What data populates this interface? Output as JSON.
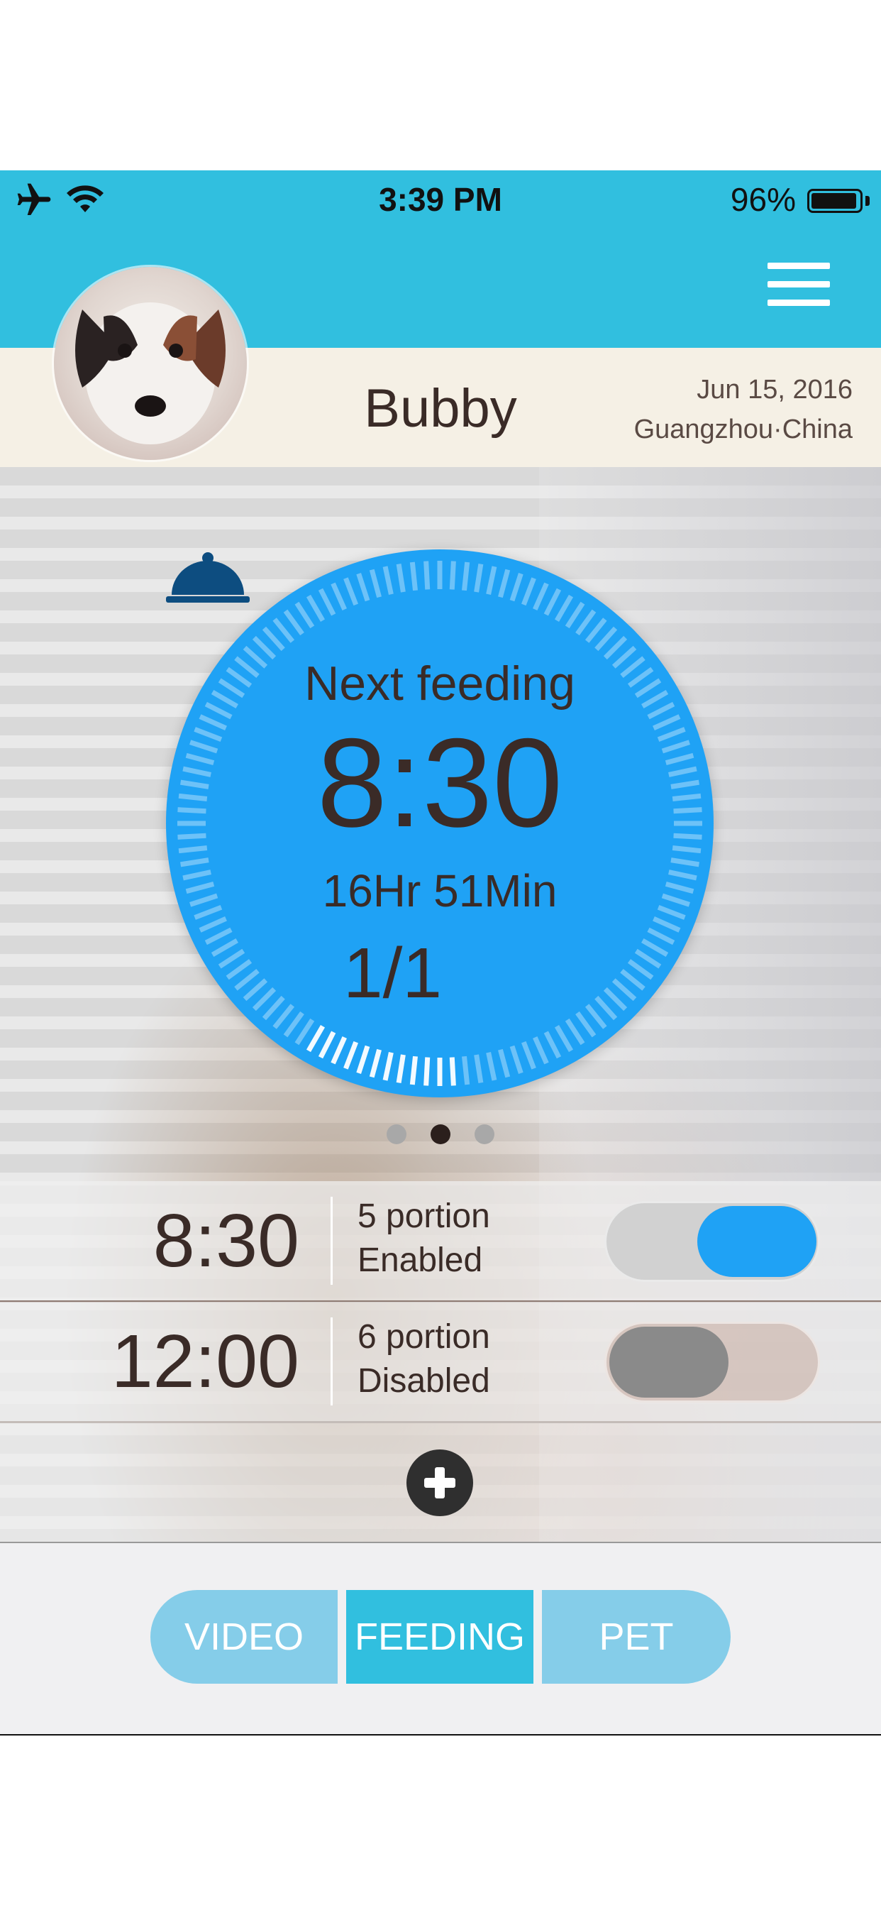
{
  "status_bar": {
    "time": "3:39 PM",
    "battery": "96%",
    "battery_level": 0.96
  },
  "header": {
    "menu_icon": "hamburger-menu-icon"
  },
  "profile": {
    "pet_name": "Bubby",
    "date": "Jun 15, 2016",
    "location": "Guangzhou·China"
  },
  "feeding": {
    "label": "Next feeding",
    "time": "8:30",
    "remaining": "16Hr 51Min",
    "count": "1/1",
    "count_icon": "food-bell-icon",
    "progress": 0.1
  },
  "pager": {
    "count": 3,
    "active": 1
  },
  "schedule": [
    {
      "time": "8:30",
      "portion": "5 portion",
      "status": "Enabled",
      "enabled": true
    },
    {
      "time": "12:00",
      "portion": "6 portion",
      "status": "Disabled",
      "enabled": false
    }
  ],
  "add_icon": "plus-circle-icon",
  "tabs": [
    {
      "label": "VIDEO",
      "active": false
    },
    {
      "label": "FEEDING",
      "active": true
    },
    {
      "label": "PET",
      "active": false
    }
  ],
  "colors": {
    "accent": "#31bfdf",
    "dial": "#1fa2f5",
    "toggle_on": "#1fa2f5",
    "toggle_off": "#8a8a8a"
  }
}
